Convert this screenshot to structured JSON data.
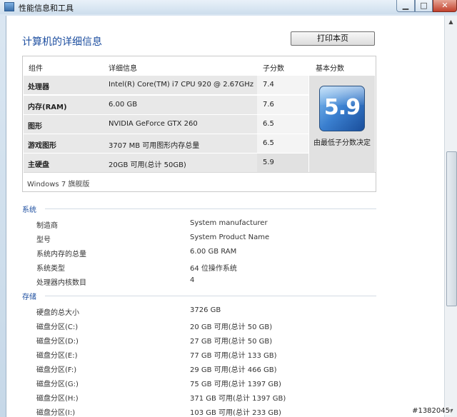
{
  "window": {
    "title": "性能信息和工具"
  },
  "page": {
    "title": "计算机的详细信息",
    "print_label": "打印本页"
  },
  "score_table": {
    "headers": {
      "component": "组件",
      "details": "详细信息",
      "subscore": "子分数",
      "base": "基本分数"
    },
    "rows": [
      {
        "component": "处理器",
        "details": "Intel(R) Core(TM) i7 CPU 920 @ 2.67GHz",
        "subscore": "7.4"
      },
      {
        "component": "内存(RAM)",
        "details": "6.00 GB",
        "subscore": "7.6"
      },
      {
        "component": "图形",
        "details": "NVIDIA GeForce GTX 260",
        "subscore": "6.5"
      },
      {
        "component": "游戏图形",
        "details": "3707 MB 可用图形内存总量",
        "subscore": "6.5"
      },
      {
        "component": "主硬盘",
        "details": "20GB 可用(总计 50GB)",
        "subscore": "5.9"
      }
    ],
    "base_score": "5.9",
    "base_caption": "由最低子分数决定",
    "edition": "Windows 7 旗舰版"
  },
  "system": {
    "heading": "系统",
    "items": [
      {
        "label": "制造商",
        "value": "System manufacturer"
      },
      {
        "label": "型号",
        "value": "System Product Name"
      },
      {
        "label": "系统内存的总量",
        "value": "6.00 GB RAM"
      },
      {
        "label": "系统类型",
        "value": "64 位操作系统"
      },
      {
        "label": "处理器内核数目",
        "value": "4"
      }
    ]
  },
  "storage": {
    "heading": "存储",
    "items": [
      {
        "label": "硬盘的总大小",
        "value": "3726 GB"
      },
      {
        "label": "磁盘分区(C:)",
        "value": "20 GB 可用(总计 50 GB)"
      },
      {
        "label": "磁盘分区(D:)",
        "value": "27 GB 可用(总计 50 GB)"
      },
      {
        "label": "磁盘分区(E:)",
        "value": "77 GB 可用(总计 133 GB)"
      },
      {
        "label": "磁盘分区(F:)",
        "value": "29 GB 可用(总计 466 GB)"
      },
      {
        "label": "磁盘分区(G:)",
        "value": "75 GB 可用(总计 1397 GB)"
      },
      {
        "label": "磁盘分区(H:)",
        "value": "371 GB 可用(总计 1397 GB)"
      },
      {
        "label": "磁盘分区(I:)",
        "value": "103 GB 可用(总计 233 GB)"
      }
    ]
  },
  "watermark": "#1382045",
  "icons": {
    "window": "performance-icon",
    "minimize": "minimize-icon",
    "maximize": "maximize-icon",
    "close": "close-icon"
  }
}
